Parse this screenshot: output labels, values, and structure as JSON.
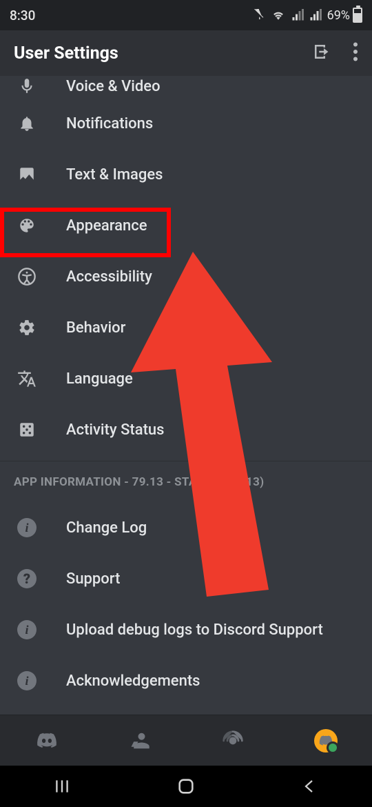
{
  "statusbar": {
    "time": "8:30",
    "battery_pct": "69%"
  },
  "appbar": {
    "title": "User Settings"
  },
  "settings": {
    "voice_video": "Voice & Video",
    "notifications": "Notifications",
    "text_images": "Text & Images",
    "appearance": "Appearance",
    "accessibility": "Accessibility",
    "behavior": "Behavior",
    "language": "Language",
    "activity_status": "Activity Status"
  },
  "app_info": {
    "header": "APP INFORMATION - 79.13 - STABLE (79013)",
    "change_log": "Change Log",
    "support": "Support",
    "upload_logs": "Upload debug logs to Discord Support",
    "acknowledgements": "Acknowledgements"
  },
  "annotation": {
    "highlighted_item": "appearance",
    "arrow_color": "#ef3b2c"
  }
}
